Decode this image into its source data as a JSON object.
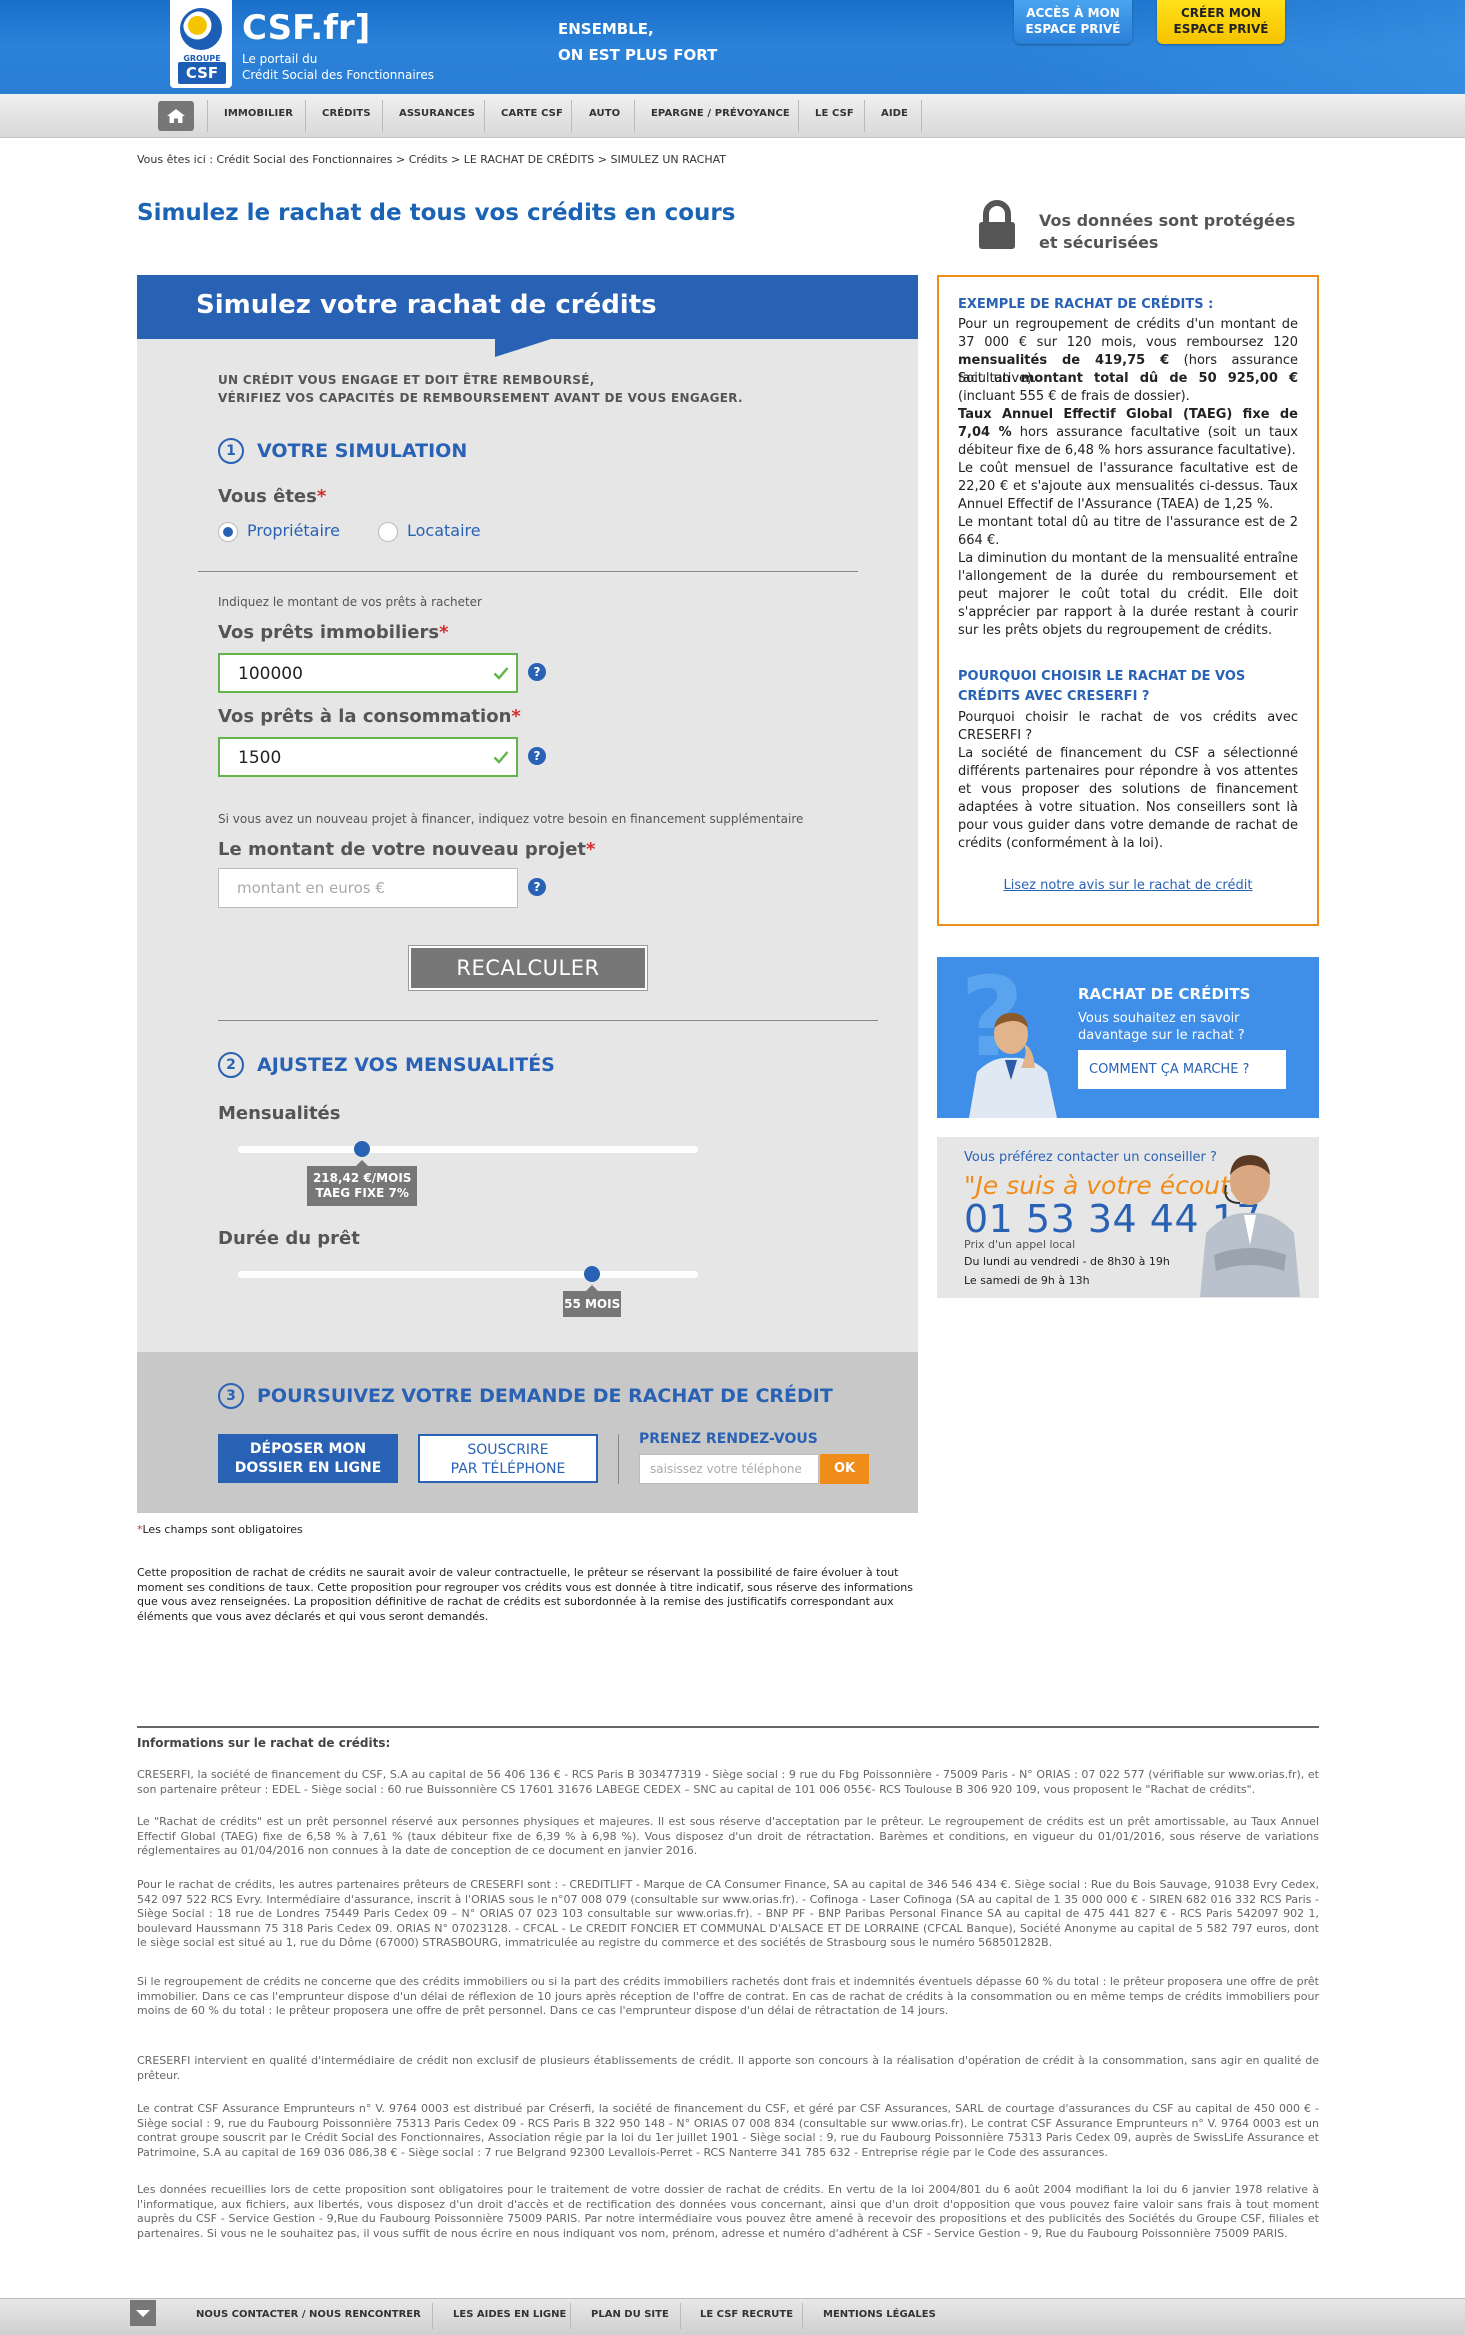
{
  "header": {
    "logo_groupe": "GROUPE",
    "logo_csf": "CSF",
    "site_name": "CSF.fr]",
    "tagline_1": "Le portail du",
    "tagline_2": "Crédit Social des Fonctionnaires",
    "slogan_1": "ENSEMBLE,",
    "slogan_2": "ON EST PLUS FORT",
    "btn_espace_1": "ACCÈS À MON",
    "btn_espace_2": "ESPACE PRIVÉ",
    "btn_creer_1": "CRÉER MON",
    "btn_creer_2": "ESPACE PRIVÉ"
  },
  "nav": {
    "items": [
      "IMMOBILIER",
      "CRÉDITS",
      "ASSURANCES",
      "CARTE CSF",
      "AUTO",
      "EPARGNE / PRÉVOYANCE",
      "LE CSF",
      "AIDE"
    ]
  },
  "breadcrumb": "Vous êtes ici : Crédit Social des Fonctionnaires > Crédits > LE RACHAT DE CRÉDITS > SIMULEZ UN RACHAT",
  "page_title": "Simulez le rachat de tous vos crédits en cours",
  "secure": {
    "line_1": "Vos données sont protégées",
    "line_2": "et sécurisées"
  },
  "form": {
    "title": "Simulez votre rachat de crédits",
    "warning_1": "UN CRÉDIT VOUS ENGAGE ET DOIT ÊTRE REMBOURSÉ,",
    "warning_2": "VÉRIFIEZ VOS CAPACITÉS DE REMBOURSEMENT AVANT DE VOUS ENGAGER.",
    "step1": {
      "num": "1",
      "title": "VOTRE SIMULATION"
    },
    "vous_etes_label": "Vous êtes",
    "radio_proprietaire": "Propriétaire",
    "radio_locataire": "Locataire",
    "selected_status": "Propriétaire",
    "note_prets": "Indiquez le montant de vos prêts à racheter",
    "immo_label": "Vos prêts immobiliers",
    "immo_value": "100000",
    "conso_label": "Vos prêts à la consommation",
    "conso_value": "1500",
    "note_projet": "Si vous avez un nouveau projet à financer, indiquez votre besoin en financement supplémentaire",
    "projet_label": "Le montant de votre nouveau projet",
    "projet_placeholder": "montant en euros €",
    "recalc_label": "RECALCULER",
    "step2": {
      "num": "2",
      "title": "AJUSTEZ VOS MENSUALITÉS"
    },
    "mensualites_label": "Mensualités",
    "mensualites_tooltip_1": "218,42 €/MOIS",
    "mensualites_tooltip_2": "TAEG FIXE 7%",
    "mensualites_fraction": 0.27,
    "duree_label": "Durée du prêt",
    "duree_tooltip": "55 MOIS",
    "duree_fraction": 0.77,
    "step3": {
      "num": "3",
      "title": "POURSUIVEZ VOTRE DEMANDE DE RACHAT DE CRÉDIT"
    },
    "btn_deposer_1": "DÉPOSER MON",
    "btn_deposer_2": "DOSSIER EN LIGNE",
    "btn_souscrire_1": "SOUSCRIRE",
    "btn_souscrire_2": "PAR TÉLÉPHONE",
    "rdv_label": "PRENEZ RENDEZ-VOUS",
    "phone_placeholder": "saisissez votre téléphone",
    "ok_label": "OK",
    "help_glyph": "?",
    "required_mark": "*",
    "required_note": "Les champs sont obligatoires"
  },
  "disclaimer": "Cette proposition de rachat de crédits ne saurait avoir de valeur contractuelle, le prêteur se réservant la possibilité de faire évoluer à tout moment ses conditions de taux. Cette proposition pour regrouper vos crédits vous est donnée à titre indicatif, sous réserve des informations que vous avez renseignées. La proposition définitive de rachat de crédits est subordonnée à la remise des justificatifs correspondant aux éléments que vous avez déclarés et qui vous seront demandés.",
  "example": {
    "title": "EXEMPLE DE RACHAT DE CRÉDITS :",
    "p1_a": "Pour un regroupement de crédits d'un montant de 37 000 € sur 120 mois, vous remboursez 120 ",
    "p1_b": "mensualités de 419,75 €",
    "p1_c": " (hors assurance facultative).",
    "p2_a": "Soit un ",
    "p2_b": "montant total dû de 50 925,00 €",
    "p2_c": " (incluant 555 € de frais de dossier).",
    "p3_a": "Taux Annuel Effectif Global (TAEG) fixe de 7,04 %",
    "p3_b": " hors assurance facultative (soit un taux débiteur fixe de 6,48 % hors assurance facultative).",
    "p4": "Le coût mensuel de l'assurance facultative est de 22,20 € et s'ajoute aux mensualités ci-dessus. Taux Annuel Effectif de l'Assurance (TAEA) de 1,25 %.",
    "p5": "Le montant total dû au titre de l'assurance est de 2 664 €.",
    "p6": "La diminution du montant de la mensualité entraîne l'allongement de la durée du remboursement et peut majorer le coût total du crédit. Elle doit s'apprécier par rapport à la durée restant à courir sur les prêts objets du regroupement de crédits.",
    "why_title": "POURQUOI CHOISIR LE RACHAT DE VOS CRÉDITS AVEC CRESERFI ?",
    "why_p1": "Pourquoi choisir le rachat de vos crédits avec CRESERFI ?",
    "why_p2": "La société de financement du CSF a sélectionné différents partenaires pour répondre à vos attentes et vous proposer des solutions de financement adaptées à votre situation. Nos conseillers sont là pour vous guider dans votre demande de rachat de crédits (conformément à la loi).",
    "avis_link": "Lisez notre avis sur le rachat de crédit"
  },
  "rachat": {
    "qmark": "?",
    "title": "RACHAT DE CRÉDITS",
    "sub_1": "Vous souhaitez en savoir",
    "sub_2": "davantage sur le rachat ?",
    "btn": "COMMENT ÇA MARCHE ?"
  },
  "contact": {
    "question": "Vous préférez contacter un conseiller ?",
    "quote": "\"Je suis à votre écoute\"",
    "phone": "01 53 34 44 17",
    "price": "Prix d'un appel local",
    "hours_1": "Du lundi au vendredi - de 8h30 à 19h",
    "hours_2": "Le samedi de 9h à 13h"
  },
  "info": {
    "title": "Informations sur le rachat de crédits:",
    "paragraphs": [
      "CRESERFI, la société de financement du CSF, S.A au capital de 56 406 136 € - RCS Paris B 303477319 - Siège social : 9 rue du Fbg Poissonnière - 75009 Paris - N° ORIAS : 07 022 577 (vérifiable sur www.orias.fr), et son partenaire prêteur : EDEL - Siège social : 60 rue Buissonnière CS 17601 31676 LABEGE CEDEX – SNC au capital de 101 006 055€- RCS Toulouse B 306 920 109, vous proposent le \"Rachat de crédits\".",
      "Le \"Rachat de crédits\" est un prêt personnel réservé aux personnes physiques et majeures. Il est sous réserve d'acceptation par le prêteur. Le regroupement de crédits est un prêt amortissable, au Taux Annuel Effectif Global (TAEG) fixe de 6,58 % à 7,61 % (taux débiteur fixe de 6,39 % à 6,98 %). Vous disposez d'un droit de rétractation. Barèmes et conditions, en vigueur du 01/01/2016, sous réserve de variations réglementaires au 01/04/2016 non connues à la date de conception de ce document en janvier 2016.",
      "Pour le rachat de crédits, les autres partenaires prêteurs de CRESERFI sont : - CREDITLIFT - Marque de CA Consumer Finance, SA au capital de 346 546 434 €. Siège social : Rue du Bois Sauvage, 91038 Evry Cedex, 542 097 522 RCS Evry. Intermédiaire d'assurance, inscrit à l'ORIAS sous le n°07 008 079 (consultable sur www.orias.fr). - Cofinoga - Laser Cofinoga (SA au capital de 1 35 000 000 € - SIREN 682 016 332 RCS Paris - Siège Social : 18 rue de Londres 75449 Paris Cedex 09 – N° ORIAS 07 023 103 consultable sur www.orias.fr). - BNP PF - BNP Paribas Personal Finance SA au capital de 475 441 827 € - RCS Paris 542097 902 1, boulevard Haussmann 75 318 Paris Cedex 09. ORIAS N° 07023128. - CFCAL - Le CREDIT FONCIER ET COMMUNAL D'ALSACE ET DE LORRAINE (CFCAL Banque), Société Anonyme au capital de 5 582 797 euros, dont le siège social est situé au 1, rue du Dôme (67000) STRASBOURG, immatriculée au registre du commerce et des sociétés de Strasbourg sous le numéro 568501282B.",
      "Si le regroupement de crédits ne concerne que des crédits immobiliers ou si la part des crédits immobiliers rachetés dont frais et indemnités éventuels dépasse 60 % du total : le prêteur proposera une offre de prêt immobilier. Dans ce cas l'emprunteur dispose d'un délai de réflexion de 10 jours après réception de l'offre de contrat. En cas de rachat de crédits à la consommation ou en même temps de crédits immobiliers pour moins de 60 % du total : le prêteur proposera une offre de prêt personnel. Dans ce cas l'emprunteur dispose d'un délai de rétractation de 14 jours.",
      "CRESERFI intervient en qualité d'intermédiaire de crédit non exclusif de plusieurs établissements de crédit. Il apporte son concours à la réalisation d'opération de crédit à la consommation, sans agir en qualité de prêteur.",
      "Le contrat CSF Assurance Emprunteurs n° V. 9764 0003 est distribué par Créserfi, la société de financement du CSF, et géré par CSF Assurances, SARL de courtage d'assurances du CSF au capital de 450 000 € - Siège social : 9, rue du Faubourg Poissonnière 75313 Paris Cedex 09 - RCS Paris B 322 950 148 - N° ORIAS 07 008 834 (consultable sur www.orias.fr). Le contrat CSF Assurance Emprunteurs n° V. 9764 0003 est un contrat groupe souscrit par le Crédit Social des Fonctionnaires, Association régie par la loi du 1er juillet 1901 - Siège social : 9, rue du Faubourg Poissonnière 75313 Paris Cedex 09, auprès de SwissLife Assurance et Patrimoine, S.A au capital de 169 036 086,38 € - Siège social : 7 rue Belgrand 92300 Levallois-Perret - RCS Nanterre 341 785 632 - Entreprise régie par le Code des assurances.",
      "Les données recueillies lors de cette proposition sont obligatoires pour le traitement de votre dossier de rachat de crédits. En vertu de la loi 2004/801 du 6 août 2004 modifiant la loi du 6 janvier 1978 relative à l'informatique, aux fichiers, aux libertés, vous disposez d'un droit d'accès et de rectification des données vous concernant, ainsi que d'un droit d'opposition que vous pouvez faire valoir sans frais à tout moment auprès du CSF - Service Gestion - 9,Rue du Faubourg Poissonnière 75009 PARIS. Par notre intermédiaire vous pouvez être amené à recevoir des propositions et des publicités des Sociétés du Groupe CSF, filiales et partenaires. Si vous ne le souhaitez pas, il vous suffit de nous écrire en nous indiquant vos nom, prénom, adresse et numéro d'adhérent à CSF - Service Gestion - 9, Rue du Faubourg Poissonnière 75009 PARIS."
    ]
  },
  "footer": {
    "items": [
      "NOUS CONTACTER / NOUS RENCONTRER",
      "LES AIDES EN LIGNE",
      "PLAN DU SITE",
      "LE CSF RECRUTE",
      "MENTIONS LÉGALES"
    ]
  },
  "colors": {
    "brand_blue": "#2962b4",
    "accent_orange": "#f08c1a",
    "accent_yellow": "#f5c200",
    "valid_green": "#61b54a",
    "required_red": "#d42e2e"
  }
}
